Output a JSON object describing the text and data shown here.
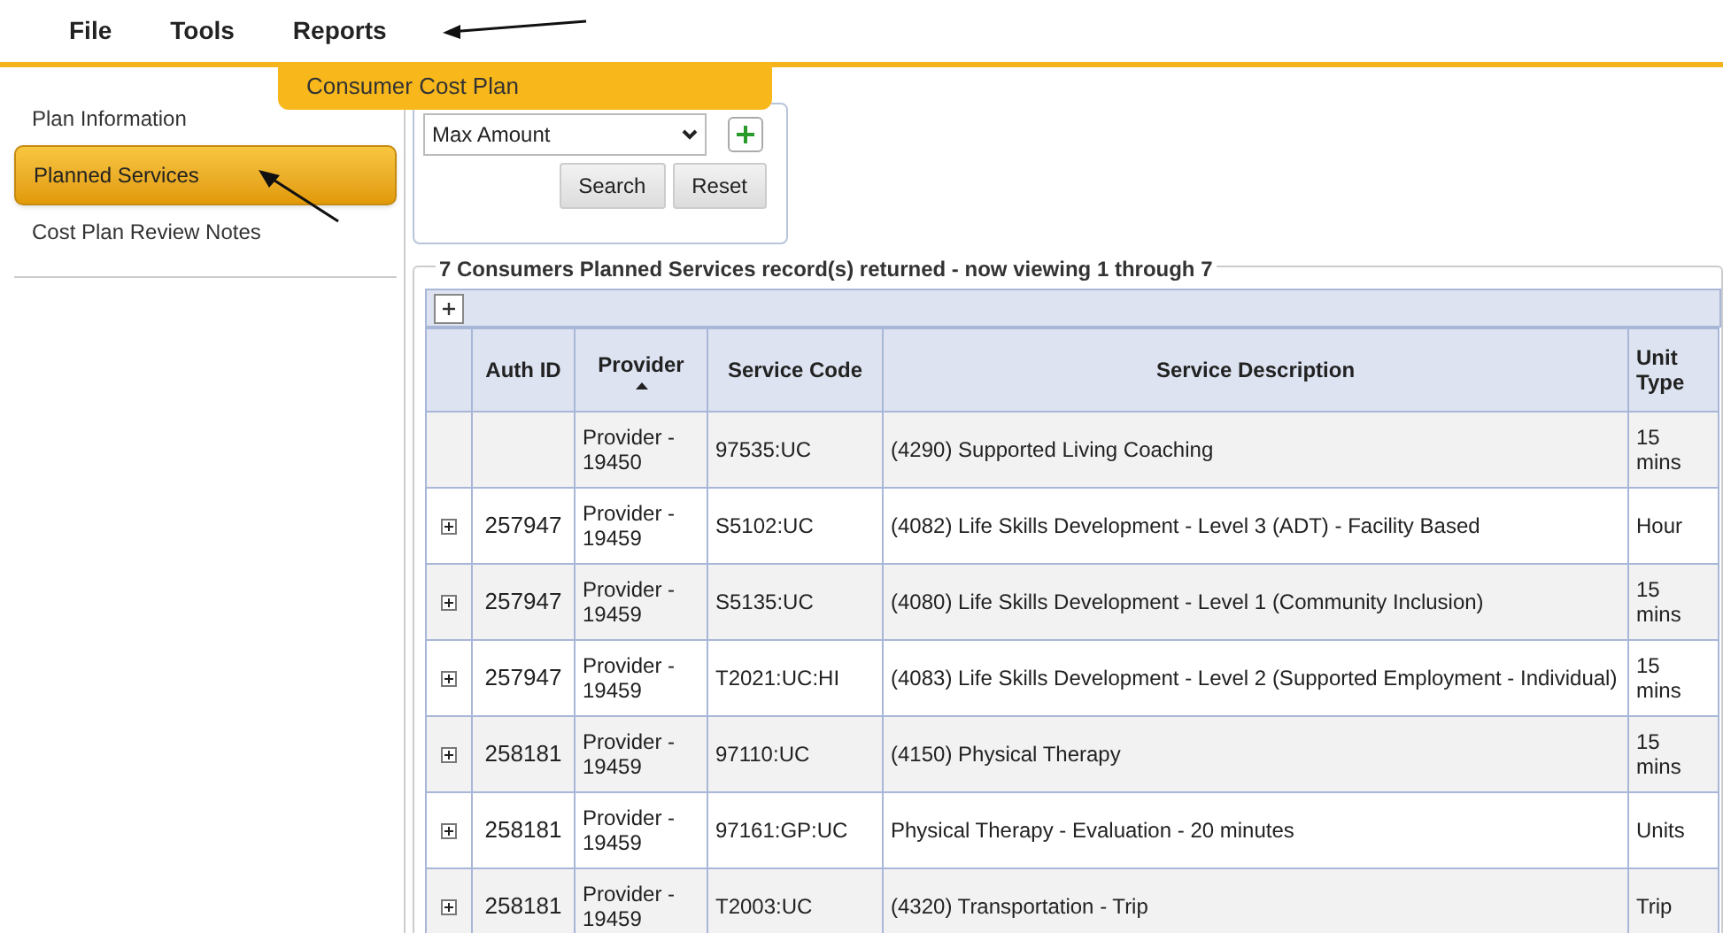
{
  "menu": [
    "File",
    "Tools",
    "Reports"
  ],
  "menu_dropdown": {
    "items": [
      "Consumer Cost Plan"
    ]
  },
  "sidebar": {
    "items": [
      {
        "label": "Plan Information",
        "selected": false
      },
      {
        "label": "Planned Services",
        "selected": true
      },
      {
        "label": "Cost Plan Review Notes",
        "selected": false
      }
    ]
  },
  "filter": {
    "select_value": "Max Amount",
    "buttons": [
      "Search",
      "Reset"
    ]
  },
  "results": {
    "legend": "7 Consumers Planned Services record(s) returned - now viewing 1 through 7",
    "table": {
      "columns": [
        {
          "label": "Auth ID",
          "sorted": false
        },
        {
          "label": "Provider",
          "sorted": true
        },
        {
          "label": "Service Code",
          "sorted": false
        },
        {
          "label": "Service Description",
          "sorted": false
        },
        {
          "label": "Unit Type",
          "sorted": false
        }
      ],
      "rows": [
        {
          "expandable": false,
          "cells": [
            "",
            "Provider - 19450",
            "97535:UC",
            "(4290) Supported Living Coaching",
            "15 mins"
          ]
        },
        {
          "expandable": true,
          "cells": [
            "257947",
            "Provider - 19459",
            "S5102:UC",
            "(4082) Life Skills Development - Level 3 (ADT) - Facility Based",
            "Hour"
          ]
        },
        {
          "expandable": true,
          "cells": [
            "257947",
            "Provider - 19459",
            "S5135:UC",
            "(4080) Life Skills Development - Level 1 (Community Inclusion)",
            "15 mins"
          ]
        },
        {
          "expandable": true,
          "cells": [
            "257947",
            "Provider - 19459",
            "T2021:UC:HI",
            "(4083) Life Skills Development - Level 2 (Supported Employment - Individual)",
            "15 mins"
          ]
        },
        {
          "expandable": true,
          "cells": [
            "258181",
            "Provider - 19459",
            "97110:UC",
            "(4150) Physical Therapy",
            "15 mins"
          ]
        },
        {
          "expandable": true,
          "cells": [
            "258181",
            "Provider - 19459",
            "97161:GP:UC",
            "Physical Therapy - Evaluation - 20 minutes",
            "Units"
          ]
        },
        {
          "expandable": true,
          "cells": [
            "258181",
            "Provider - 19459",
            "T2003:UC",
            "(4320) Transportation - Trip",
            "Trip"
          ]
        }
      ]
    }
  }
}
